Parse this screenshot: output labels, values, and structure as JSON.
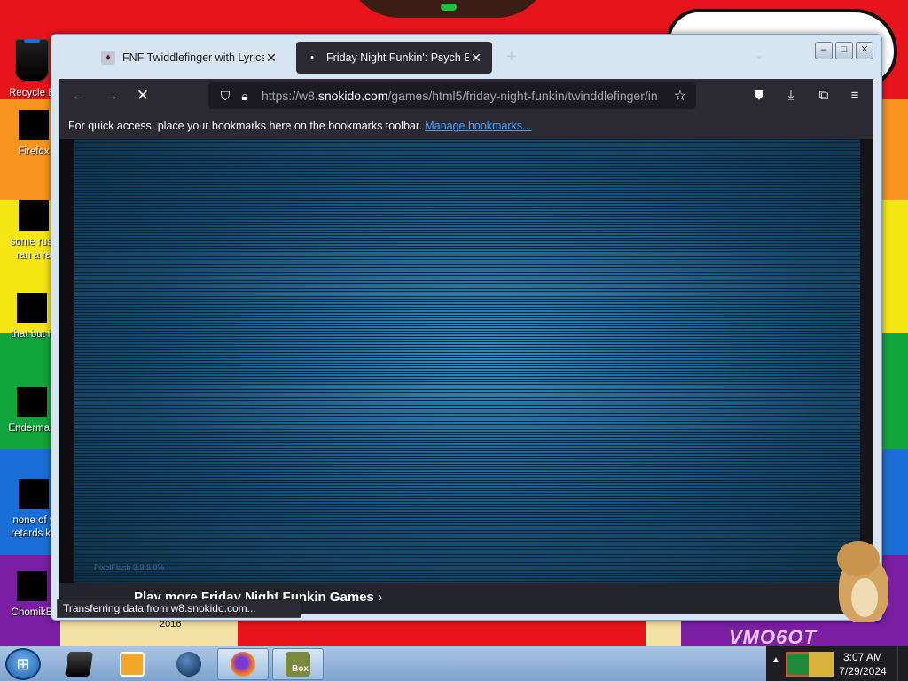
{
  "desktop": {
    "icons": [
      {
        "label": "Recycle B"
      },
      {
        "label": "Firefox"
      },
      {
        "label": "some russ ran a ra"
      },
      {
        "label": "that but it"
      },
      {
        "label": "Enderman"
      },
      {
        "label": "none of y retards kn"
      },
      {
        "label": "ChomikB"
      }
    ],
    "year_label": "2016",
    "vm_label": "VMO6OT"
  },
  "browser": {
    "tabs": [
      {
        "title": "FNF Twiddlefinger with Lyrics –",
        "active": false
      },
      {
        "title": "Friday Night Funkin': Psych Eng",
        "active": true
      }
    ],
    "new_tab": "+",
    "url_base": "https://w8.",
    "url_domain": "snokido.com",
    "url_path": "/games/html5/friday-night-funkin/twinddlefinger/in",
    "bookmarks_text": "For quick access, place your bookmarks here on the bookmarks toolbar.",
    "bookmarks_link": "Manage bookmarks...",
    "engine_label": "PixelFlash 3.3.3 0%",
    "more_games": "Play more Friday Night Funkin Games",
    "status": "Transferring data from w8.snokido.com..."
  },
  "taskbar": {
    "time": "3:07 AM",
    "date": "7/29/2024",
    "apps": [
      {
        "name": "terminal"
      },
      {
        "name": "media-player"
      },
      {
        "name": "globe"
      },
      {
        "name": "firefox",
        "active": true
      },
      {
        "name": "box",
        "label": "Box",
        "active": true
      }
    ]
  },
  "colors": {
    "firefox_chrome": "#2b2a33",
    "link": "#45a1ff",
    "game_bg": "#1e6a9b"
  }
}
